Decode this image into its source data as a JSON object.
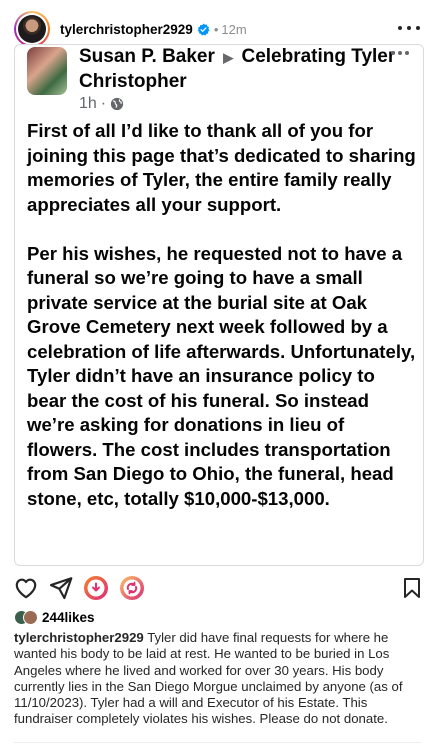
{
  "post": {
    "username": "tylerchristopher2929",
    "separator": "•",
    "time": "12m"
  },
  "shared_post": {
    "author": "Susan P. Baker",
    "arrow": "▶",
    "target": "Celebrating Tyler Christopher",
    "time": "1h",
    "meta_sep": "·",
    "paragraphs": [
      "First of all I’d like to thank all of you for joining this page that’s dedicated to sharing memories of Tyler, the entire family really appreciates all your support.",
      "Per his wishes, he requested not to have a funeral so we’re going to have a small private service at the burial site at Oak Grove Cemetery next week followed by a celebration of life afterwards. Unfortunately, Tyler didn’t have an insurance policy to bear the cost of his funeral. So instead we’re asking for donations in lieu of flowers. The cost includes transportation from San Diego to Ohio, the funeral, head stone, etc, totally $10,000-$13,000."
    ]
  },
  "engagement": {
    "likes": "244likes"
  },
  "caption": {
    "username": "tylerchristopher2929",
    "text": "Tyler did have final requests for where he wanted his body to be laid at rest. He wanted to be buried in Los Angeles where he lived and worked for over 30 years. His body currently lies in the San Diego Morgue unclaimed by anyone (as of 11/10/2023). Tyler had a will and Executor of his Estate. This fundraiser completely violates his wishes. Please do not donate."
  },
  "icons": [
    "heart-icon",
    "share-icon",
    "donate-icon",
    "remix-icon",
    "bookmark-icon",
    "verified-icon",
    "globe-icon",
    "more-icon"
  ],
  "colors": {
    "verified": "#0095f6",
    "secondary_text": "#8e8e8e",
    "donate_gradient": [
      "#f58529",
      "#dd2a7b"
    ],
    "remix_gradient": [
      "#fdc468",
      "#d62976"
    ]
  }
}
